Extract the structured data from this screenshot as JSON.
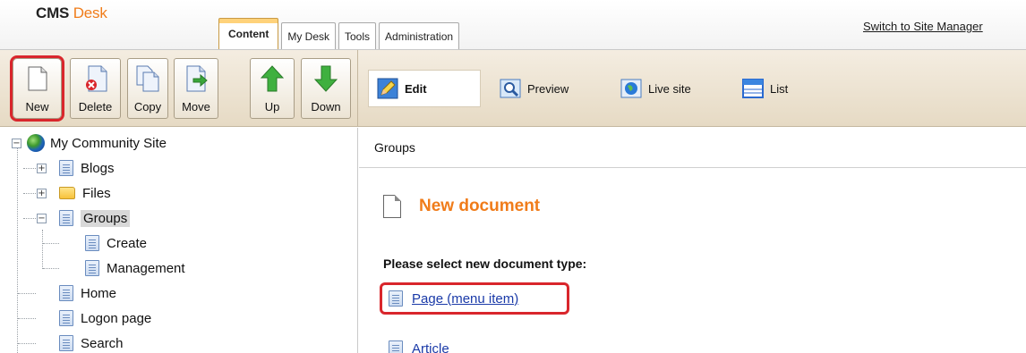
{
  "app": {
    "logo_main": "CMS",
    "logo_accent": "Desk",
    "switch_link": "Switch to Site Manager"
  },
  "tabs": [
    {
      "label": "Content",
      "active": true
    },
    {
      "label": "My Desk",
      "active": false
    },
    {
      "label": "Tools",
      "active": false
    },
    {
      "label": "Administration",
      "active": false
    }
  ],
  "toolbar": {
    "buttons": [
      {
        "label": "New",
        "icon": "new-document-icon",
        "highlighted": true
      },
      {
        "label": "Delete",
        "icon": "delete-document-icon",
        "highlighted": false
      },
      {
        "label": "Copy",
        "icon": "copy-document-icon",
        "highlighted": false
      },
      {
        "label": "Move",
        "icon": "move-document-icon",
        "highlighted": false
      },
      {
        "label": "Up",
        "icon": "arrow-up-icon",
        "highlighted": false
      },
      {
        "label": "Down",
        "icon": "arrow-down-icon",
        "highlighted": false
      }
    ],
    "views": [
      {
        "label": "Edit",
        "icon": "edit-pencil-icon",
        "active": true
      },
      {
        "label": "Preview",
        "icon": "preview-magnifier-icon",
        "active": false
      },
      {
        "label": "Live site",
        "icon": "live-site-globe-icon",
        "active": false
      },
      {
        "label": "List",
        "icon": "list-icon",
        "active": false
      }
    ]
  },
  "tree": {
    "root": "My Community Site",
    "nodes": [
      {
        "label": "Blogs",
        "type": "document",
        "expander": "+"
      },
      {
        "label": "Files",
        "type": "folder",
        "expander": "+"
      },
      {
        "label": "Groups",
        "type": "document",
        "expander": "−",
        "selected": true
      },
      {
        "label": "Create",
        "type": "document"
      },
      {
        "label": "Management",
        "type": "document"
      },
      {
        "label": "Home",
        "type": "document"
      },
      {
        "label": "Logon page",
        "type": "document"
      },
      {
        "label": "Search",
        "type": "document"
      }
    ]
  },
  "content": {
    "breadcrumb": "Groups",
    "title": "New document",
    "section_label": "Please select new document type:",
    "document_types": [
      {
        "label": "Page (menu item)",
        "highlighted": true
      },
      {
        "label": "Article",
        "highlighted": false
      }
    ]
  },
  "colors": {
    "accent_orange": "#f07c1a",
    "highlight_red": "#d9262c",
    "link_blue": "#1a3aa8",
    "toolbar_bg": "#ece3d2"
  }
}
